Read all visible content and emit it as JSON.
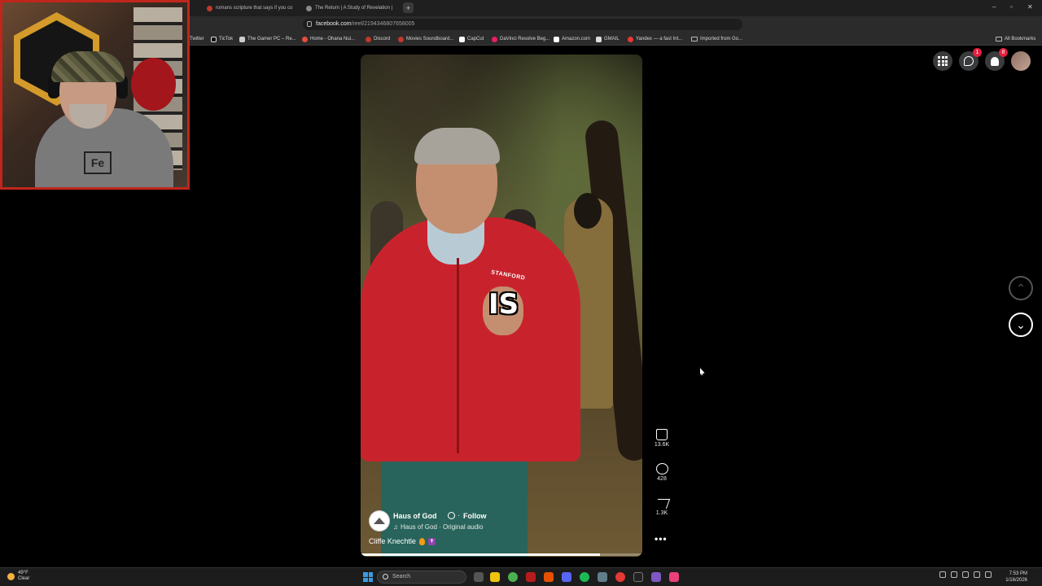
{
  "browser": {
    "tabs": [
      {
        "label": "romans scripture that says if you co"
      },
      {
        "label": "The Return | A Study of Revelation | "
      }
    ],
    "new_tab": "+",
    "window_controls": {
      "minimize": "–",
      "maximize": "▫",
      "close": "✕"
    },
    "url": {
      "host": "facebook.com",
      "path": "/reel/2194346807658005"
    },
    "bookmarks": [
      {
        "label": "Twitter"
      },
      {
        "label": "TicTok"
      },
      {
        "label": "The Gamer PC – Re..."
      },
      {
        "label": "Home - Ohana Nui..."
      },
      {
        "label": "Discord"
      },
      {
        "label": "Movies Soundboard..."
      },
      {
        "label": "CapCut"
      },
      {
        "label": "DaVinci Resolve Beg..."
      },
      {
        "label": "Amazon.com"
      },
      {
        "label": "GMAIL"
      },
      {
        "label": "Yandex — a fast Int..."
      },
      {
        "label": "Imported from Go..."
      }
    ],
    "all_bookmarks": "All Bookmarks"
  },
  "facebook": {
    "messenger_badge": "1",
    "notifications_badge": "8"
  },
  "reel": {
    "caption_word": "IS",
    "jacket_patch": "STANFORD",
    "page_name": "Haus of God",
    "follow_separator": "·",
    "follow_label": "Follow",
    "audio_note": "♫",
    "audio": "Haus of God · Original audio",
    "caption": "Cliffe Knechtle",
    "progress": 0.85
  },
  "actions": {
    "likes": "13.6K",
    "comments": "428",
    "shares": "1.3K",
    "more": "•••"
  },
  "nav": {
    "up": "⌃",
    "down": "⌄"
  },
  "taskbar": {
    "weather_temp": "49°F",
    "weather_desc": "Clear",
    "search_placeholder": "Search",
    "time": "7:53 PM",
    "date": "1/16/2026"
  },
  "colors": {
    "accent_red": "#e41e3f",
    "webcam_border": "#c0261b",
    "jacket": "#c8232c"
  }
}
